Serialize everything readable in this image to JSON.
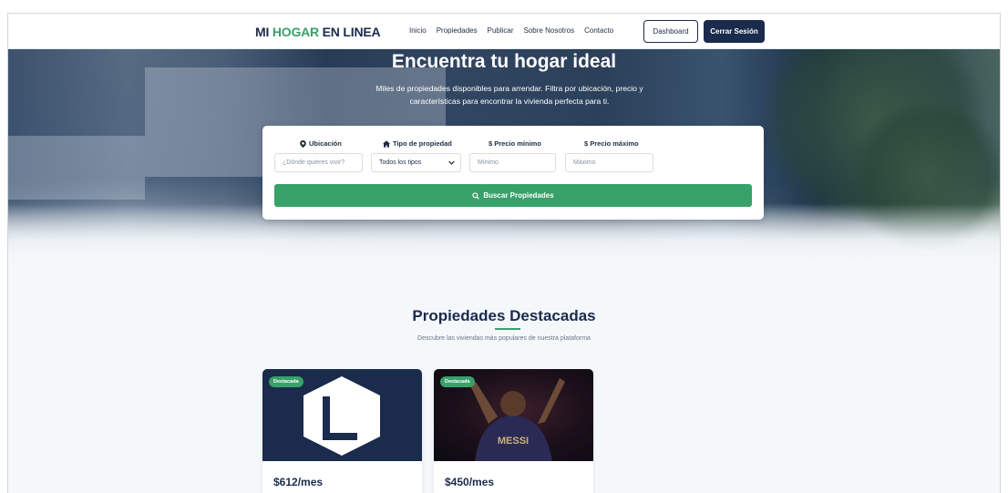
{
  "header": {
    "logo_part1": "MI ",
    "logo_accent": "HOGAR",
    "logo_part2": " EN LINEA",
    "nav": [
      "Inicio",
      "Propiedades",
      "Publicar",
      "Sobre Nosotros",
      "Contacto"
    ],
    "dashboard_label": "Dashboard",
    "logout_label": "Cerrar Sesión"
  },
  "hero": {
    "title": "Encuentra tu hogar ideal",
    "subtitle": "Miles de propiedades disponibles para arrendar. Filtra por ubicación, precio y características para encontrar la vivienda perfecta para ti."
  },
  "search": {
    "location_label": "Ubicación",
    "location_placeholder": "¿Dónde quieres vivir?",
    "type_label": "Tipo de propiedad",
    "type_selected": "Todos los tipos",
    "min_label": "$ Precio mínimo",
    "min_placeholder": "Mínimo",
    "max_label": "$ Precio máximo",
    "max_placeholder": "Máximo",
    "button_label": "Buscar Propiedades"
  },
  "featured": {
    "title": "Propiedades Destacadas",
    "subtitle": "Descubre las viviendas más populares de nuestra plataforma",
    "cards": [
      {
        "badge": "Destacada",
        "price": "$612/mes",
        "image": "logo-hexagon-image"
      },
      {
        "badge": "Destacada",
        "price": "$450/mes",
        "image": "player-jersey-image",
        "image_text": "MESSI"
      }
    ]
  },
  "colors": {
    "brand_navy": "#1a2b4c",
    "brand_green": "#38a169"
  }
}
